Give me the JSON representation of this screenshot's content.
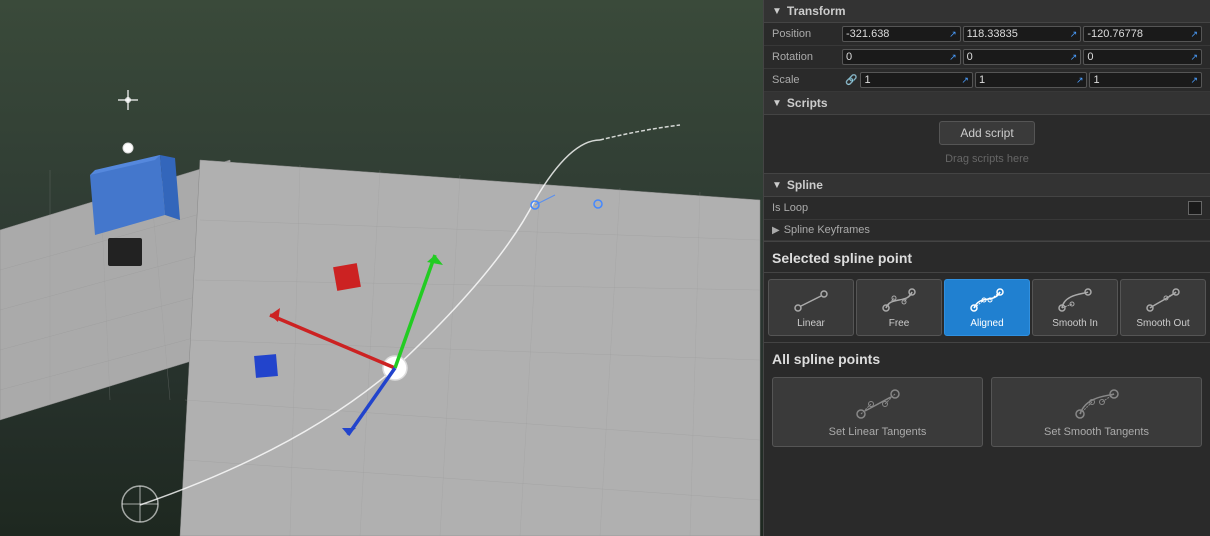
{
  "viewport": {
    "label": "3D Viewport"
  },
  "inspector": {
    "transform": {
      "header": "Transform",
      "position": {
        "label": "Position",
        "x": "-321.638",
        "y": "118.33835",
        "z": "-120.76778"
      },
      "rotation": {
        "label": "Rotation",
        "x": "0",
        "y": "0",
        "z": "0"
      },
      "scale": {
        "label": "Scale",
        "x": "1",
        "y": "1",
        "z": "1"
      }
    },
    "scripts": {
      "header": "Scripts",
      "add_label": "Add script",
      "drag_label": "Drag scripts here"
    },
    "spline": {
      "header": "Spline",
      "is_loop_label": "Is Loop",
      "keyframes_label": "Spline Keyframes",
      "selected_point_header": "Selected spline point",
      "buttons": [
        {
          "id": "linear",
          "label": "Linear",
          "active": false
        },
        {
          "id": "free",
          "label": "Free",
          "active": false
        },
        {
          "id": "aligned",
          "label": "Aligned",
          "active": true
        },
        {
          "id": "smooth_in",
          "label": "Smooth In",
          "active": false
        },
        {
          "id": "smooth_out",
          "label": "Smooth Out",
          "active": false
        }
      ],
      "all_points_header": "All spline points",
      "tangent_buttons": [
        {
          "id": "linear_tangents",
          "label": "Set Linear Tangents"
        },
        {
          "id": "smooth_tangents",
          "label": "Set Smooth Tangents"
        }
      ]
    }
  }
}
